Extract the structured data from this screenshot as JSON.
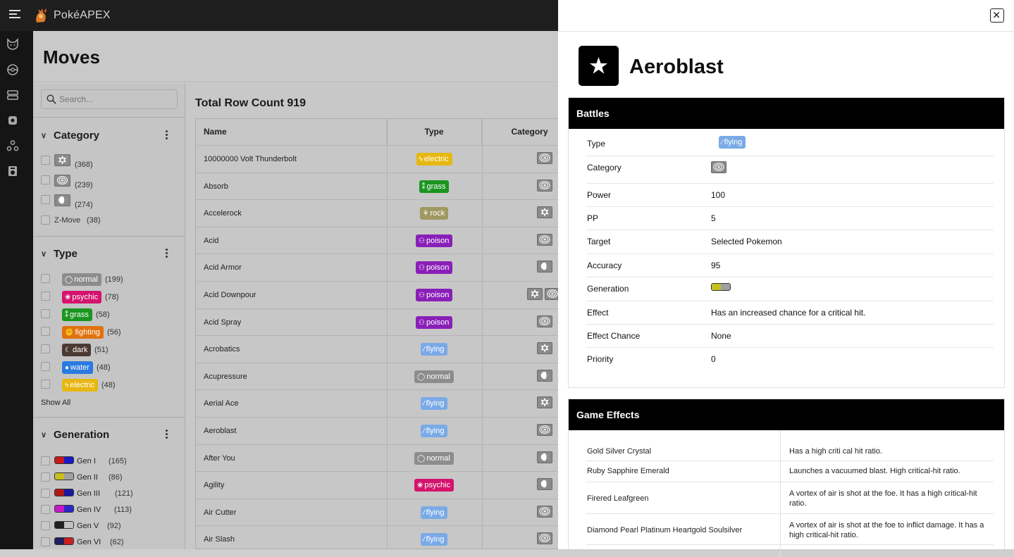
{
  "app": {
    "name": "PokéAPEX"
  },
  "rail": {
    "icons": [
      "pokemon-icon",
      "pokeball-icon",
      "items-icon",
      "berries-icon",
      "abilities-icon",
      "machines-icon"
    ]
  },
  "page": {
    "title": "Moves"
  },
  "filters": {
    "search_placeholder": "Search...",
    "category": {
      "title": "Category",
      "items": [
        {
          "icon": "physical-icon",
          "count": "(368)"
        },
        {
          "icon": "special-icon",
          "count": "(239)"
        },
        {
          "icon": "status-icon",
          "count": "(274)"
        },
        {
          "label": "Z-Move",
          "count": "(38)"
        }
      ]
    },
    "type": {
      "title": "Type",
      "items": [
        {
          "label": "normal",
          "count": "(199)",
          "color": "#8d8d8d"
        },
        {
          "label": "psychic",
          "count": "(78)",
          "color": "#d4136e"
        },
        {
          "label": "grass",
          "count": "(58)",
          "color": "#1a951f"
        },
        {
          "label": "fighting",
          "count": "(56)",
          "color": "#e0720c"
        },
        {
          "label": "dark",
          "count": "(51)",
          "color": "#4a3a32"
        },
        {
          "label": "water",
          "count": "(48)",
          "color": "#2a7ae0"
        },
        {
          "label": "electric",
          "count": "(48)",
          "color": "#e7b712"
        }
      ],
      "show_all": "Show All"
    },
    "generation": {
      "title": "Generation",
      "items": [
        {
          "label": "Gen I",
          "count": "(165)",
          "glyph": "I"
        },
        {
          "label": "Gen II",
          "count": "(86)",
          "glyph": "II"
        },
        {
          "label": "Gen III",
          "count": "(121)",
          "glyph": "III"
        },
        {
          "label": "Gen IV",
          "count": "(113)",
          "glyph": "IV"
        },
        {
          "label": "Gen V",
          "count": "(92)",
          "glyph": "V"
        },
        {
          "label": "Gen VI",
          "count": "(62)",
          "glyph": "VI"
        }
      ]
    }
  },
  "table": {
    "row_count_label": "Total Row Count 919",
    "columns": [
      "Name",
      "Type",
      "Category"
    ],
    "rows": [
      {
        "name": "10000000 Volt Thunderbolt",
        "type": "electric",
        "cat": "special"
      },
      {
        "name": "Absorb",
        "type": "grass",
        "cat": "special"
      },
      {
        "name": "Accelerock",
        "type": "rock",
        "cat": "physical"
      },
      {
        "name": "Acid",
        "type": "poison",
        "cat": "special"
      },
      {
        "name": "Acid Armor",
        "type": "poison",
        "cat": "status"
      },
      {
        "name": "Acid Downpour",
        "type": "poison",
        "cat": "physical+special"
      },
      {
        "name": "Acid Spray",
        "type": "poison",
        "cat": "special"
      },
      {
        "name": "Acrobatics",
        "type": "flying",
        "cat": "physical"
      },
      {
        "name": "Acupressure",
        "type": "normal",
        "cat": "status"
      },
      {
        "name": "Aerial Ace",
        "type": "flying",
        "cat": "physical"
      },
      {
        "name": "Aeroblast",
        "type": "flying",
        "cat": "special"
      },
      {
        "name": "After You",
        "type": "normal",
        "cat": "status"
      },
      {
        "name": "Agility",
        "type": "psychic",
        "cat": "status"
      },
      {
        "name": "Air Cutter",
        "type": "flying",
        "cat": "special"
      },
      {
        "name": "Air Slash",
        "type": "flying",
        "cat": "special"
      }
    ],
    "type_colors": {
      "electric": "#e7b712",
      "grass": "#1a951f",
      "rock": "#a09862",
      "poison": "#8a1fb8",
      "flying": "#7aaae6",
      "normal": "#8d8d8d",
      "psychic": "#d4136e"
    }
  },
  "detail": {
    "name": "Aeroblast",
    "battles": {
      "title": "Battles",
      "rows": [
        {
          "label": "Type",
          "value": "flying"
        },
        {
          "label": "Category",
          "value": ""
        },
        {
          "label": "Power",
          "value": "100"
        },
        {
          "label": "PP",
          "value": "5"
        },
        {
          "label": "Target",
          "value": "Selected Pokemon"
        },
        {
          "label": "Accuracy",
          "value": "95"
        },
        {
          "label": "Generation",
          "value": ""
        },
        {
          "label": "Effect",
          "value": "Has an increased chance for a critical hit."
        },
        {
          "label": "Effect Chance",
          "value": "None"
        },
        {
          "label": "Priority",
          "value": "0"
        }
      ]
    },
    "game_effects": {
      "title": "Game Effects",
      "rows": [
        {
          "game": "Gold Silver Crystal",
          "text": "Has a high criti cal hit ratio."
        },
        {
          "game": "Ruby Sapphire Emerald",
          "text": "Launches a vacuumed blast. High critical-hit ratio."
        },
        {
          "game": "Firered Leafgreen",
          "text": "A vortex of air is shot at the foe. It has a high critical-hit ratio."
        },
        {
          "game": "Diamond Pearl Platinum Heartgold Soulsilver",
          "text": "A vortex of air is shot at the foe to inflict damage. It has a high critical-hit ratio."
        }
      ]
    }
  }
}
